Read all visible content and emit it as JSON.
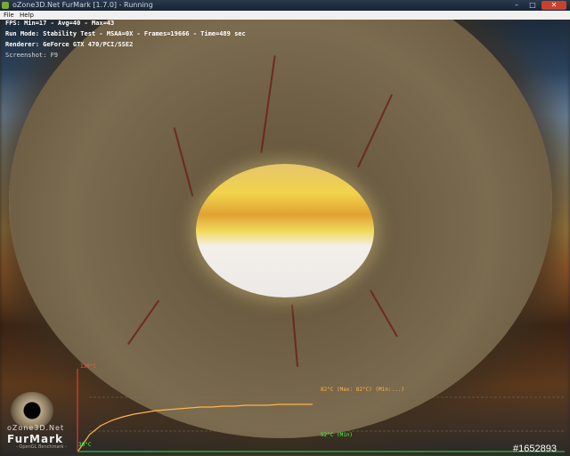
{
  "window": {
    "title": "oZone3D.Net FurMark [1.7.0] - Running",
    "controls": {
      "minimize": "–",
      "maximize": "□",
      "close": "✕"
    }
  },
  "menu": {
    "items": [
      "File",
      "Help"
    ]
  },
  "hud": {
    "fps_line": "FPS: Min=17 - Avg=40 - Max=43",
    "mode_line": "Run Mode: Stability Test - MSAA=0X - Frames=19666 - Time=489 sec",
    "renderer_line": "Renderer: GeForce GTX 470/PCI/SSE2",
    "screenshot_line": "Screenshot: F9"
  },
  "temp_graph": {
    "y_max_label": "120°C",
    "y_min_label": "30°C",
    "current_label": "82°C (Max: 82°C) (Min:...)",
    "mid_label": "52°C (Min)",
    "line_color": "#ffb54a",
    "axis_color": "#ff3b3b",
    "readings_c": [
      30,
      48,
      58,
      64,
      68,
      71,
      73,
      75,
      76,
      77,
      78,
      79,
      79,
      80,
      80,
      81,
      81,
      81,
      82,
      82,
      82,
      82
    ]
  },
  "logo": {
    "line1": "oZone3D.Net",
    "line2": "FurMark",
    "line3": "- OpenGL Benchmark -"
  },
  "watermark": "#1652893"
}
